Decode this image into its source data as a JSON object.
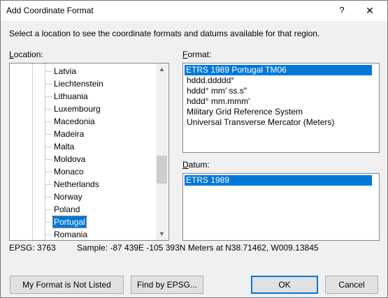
{
  "window": {
    "title": "Add Coordinate Format",
    "help_label": "?",
    "close_label": "✕"
  },
  "instructions": "Select a location to see the coordinate formats and datums available for that region.",
  "location": {
    "label_key": "L",
    "label_rest": "ocation:",
    "items": [
      "Latvia",
      "Liechtenstein",
      "Lithuania",
      "Luxembourg",
      "Macedonia",
      "Madeira",
      "Malta",
      "Moldova",
      "Monaco",
      "Netherlands",
      "Norway",
      "Poland",
      "Portugal",
      "Romania"
    ],
    "selected": "Portugal",
    "scroll_up_icon": "▲",
    "scroll_down_icon": "▼"
  },
  "format": {
    "label_key": "F",
    "label_rest": "ormat:",
    "items": [
      "ETRS 1989 Portugal TM06",
      "hddd.ddddd°",
      "hddd° mm' ss.s\"",
      "hddd° mm.mmm'",
      "Military Grid Reference System",
      "Universal Transverse Mercator (Meters)"
    ],
    "selected": "ETRS 1989 Portugal TM06"
  },
  "datum": {
    "label_key": "D",
    "label_rest": "atum:",
    "items": [
      "ETRS 1989"
    ],
    "selected": "ETRS 1989"
  },
  "status": {
    "epsg": "EPSG: 3763",
    "sample": "Sample: -87 439E  -105 393N Meters at N38.71462, W009.13845"
  },
  "buttons": {
    "not_listed": "My Format is Not Listed",
    "find_epsg": "Find by EPSG...",
    "ok": "OK",
    "cancel": "Cancel"
  },
  "colors": {
    "selection": "#0078d7",
    "dialog_bg": "#f0f0f0"
  }
}
